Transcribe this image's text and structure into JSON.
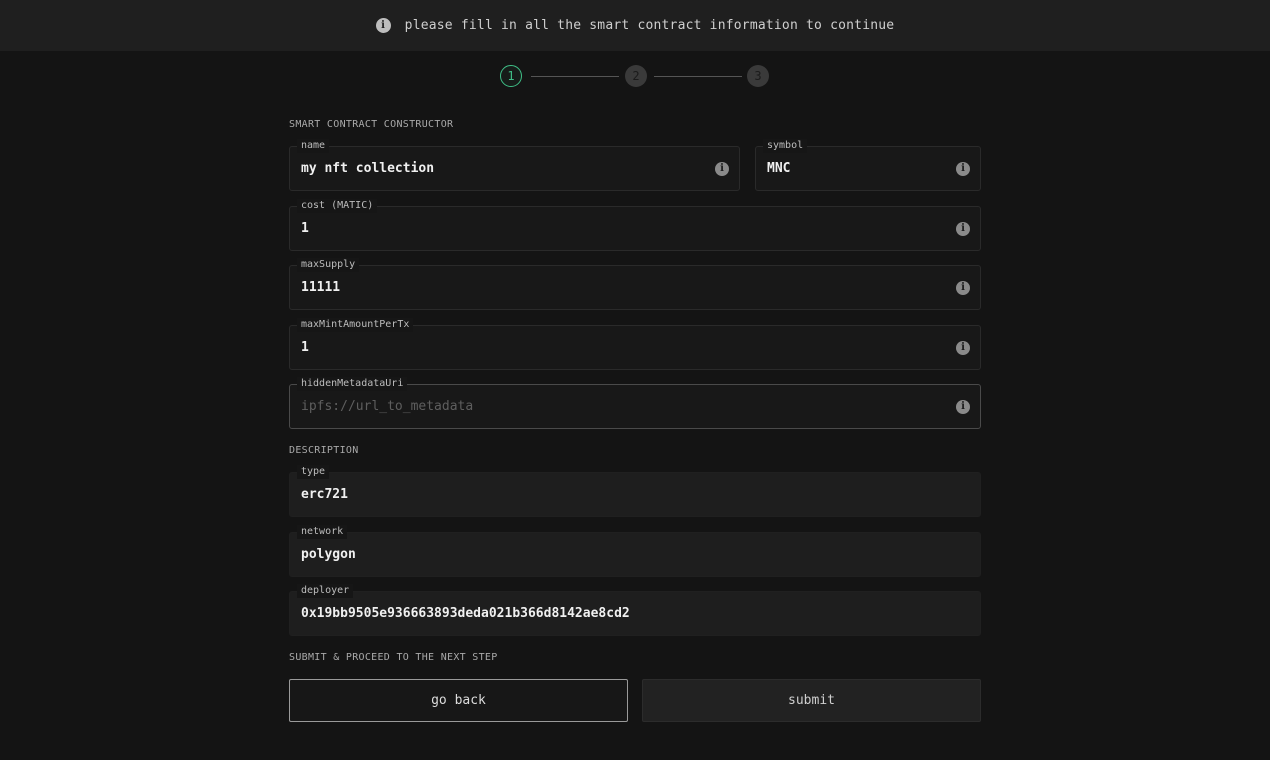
{
  "banner": {
    "message": "please fill in all the smart contract information to continue",
    "icon": "info-icon"
  },
  "stepper": {
    "steps": [
      "1",
      "2",
      "3"
    ],
    "active_step": 1,
    "accent_color": "#3fbf87"
  },
  "sections": {
    "constructor": "SMART CONTRACT CONSTRUCTOR",
    "description": "DESCRIPTION",
    "submit": "SUBMIT & PROCEED TO THE NEXT STEP"
  },
  "constructor_fields": {
    "name": {
      "label": "name",
      "value": "my nft collection"
    },
    "symbol": {
      "label": "symbol",
      "value": "MNC"
    },
    "cost": {
      "label": "cost (MATIC)",
      "value": "1"
    },
    "maxSupply": {
      "label": "maxSupply",
      "value": "11111"
    },
    "maxMintAmountPerTx": {
      "label": "maxMintAmountPerTx",
      "value": "1"
    },
    "hiddenMetadataUri": {
      "label": "hiddenMetadataUri",
      "value": "",
      "placeholder": "ipfs://url_to_metadata"
    }
  },
  "description_fields": {
    "type": {
      "label": "type",
      "value": "erc721"
    },
    "network": {
      "label": "network",
      "value": "polygon"
    },
    "deployer": {
      "label": "deployer",
      "value": "0x19bb9505e936663893deda021b366d8142ae8cd2"
    }
  },
  "buttons": {
    "back": "go back",
    "submit": "submit"
  }
}
